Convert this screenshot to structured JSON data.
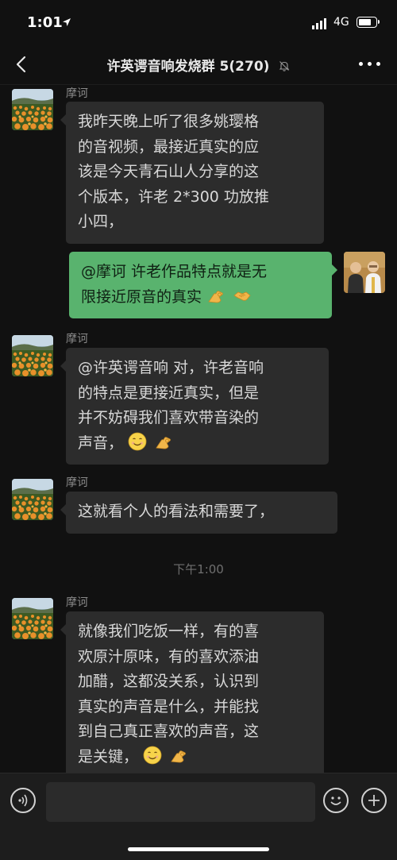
{
  "status_bar": {
    "time": "1:01",
    "network": "4G",
    "battery_percent": 80
  },
  "nav": {
    "title": "许英谔音响发烧群 5(270)",
    "back_icon": "chevron-left-icon",
    "mute_icon": "bell-off-icon",
    "more_icon": "more-dots-icon"
  },
  "messages": [
    {
      "sender": "摩诃",
      "direction": "in",
      "lines": [
        "我昨天晚上听了很多姚璎格",
        "的音视频，最接近真实的应",
        "该是今天青石山人分享的这",
        "个版本，许老 2*300 功放推",
        "小四，"
      ]
    },
    {
      "sender": "",
      "direction": "out",
      "lines": [
        "@摩诃 许老作品特点就是无",
        "限接近原音的真实"
      ],
      "emojis": [
        "ok-hand",
        "handshake"
      ]
    },
    {
      "sender": "摩诃",
      "direction": "in",
      "lines": [
        "@许英谔音响 对，许老音响",
        "的特点是更接近真实，但是",
        "并不妨碍我们喜欢带音染的",
        "声音，"
      ],
      "emojis": [
        "smile",
        "ok-hand"
      ]
    },
    {
      "sender": "摩诃",
      "direction": "in",
      "lines": [
        "这就看个人的看法和需要了，"
      ]
    },
    {
      "sender": "摩诃",
      "direction": "in",
      "lines": [
        "就像我们吃饭一样，有的喜",
        "欢原汁原味，有的喜欢添油",
        "加醋，这都没关系，认识到",
        "真实的声音是什么，并能找",
        "到自己真正喜欢的声音，这",
        "是关键，"
      ],
      "emojis": [
        "smile",
        "ok-hand"
      ]
    }
  ],
  "time_separator": "下午1:00",
  "input_bar": {
    "voice_icon": "voice-icon",
    "emoji_icon": "emoji-icon",
    "plus_icon": "plus-icon",
    "text": ""
  },
  "colors": {
    "background": "#111111",
    "incoming_bubble": "#2c2c2c",
    "outgoing_bubble": "#59b36e"
  }
}
